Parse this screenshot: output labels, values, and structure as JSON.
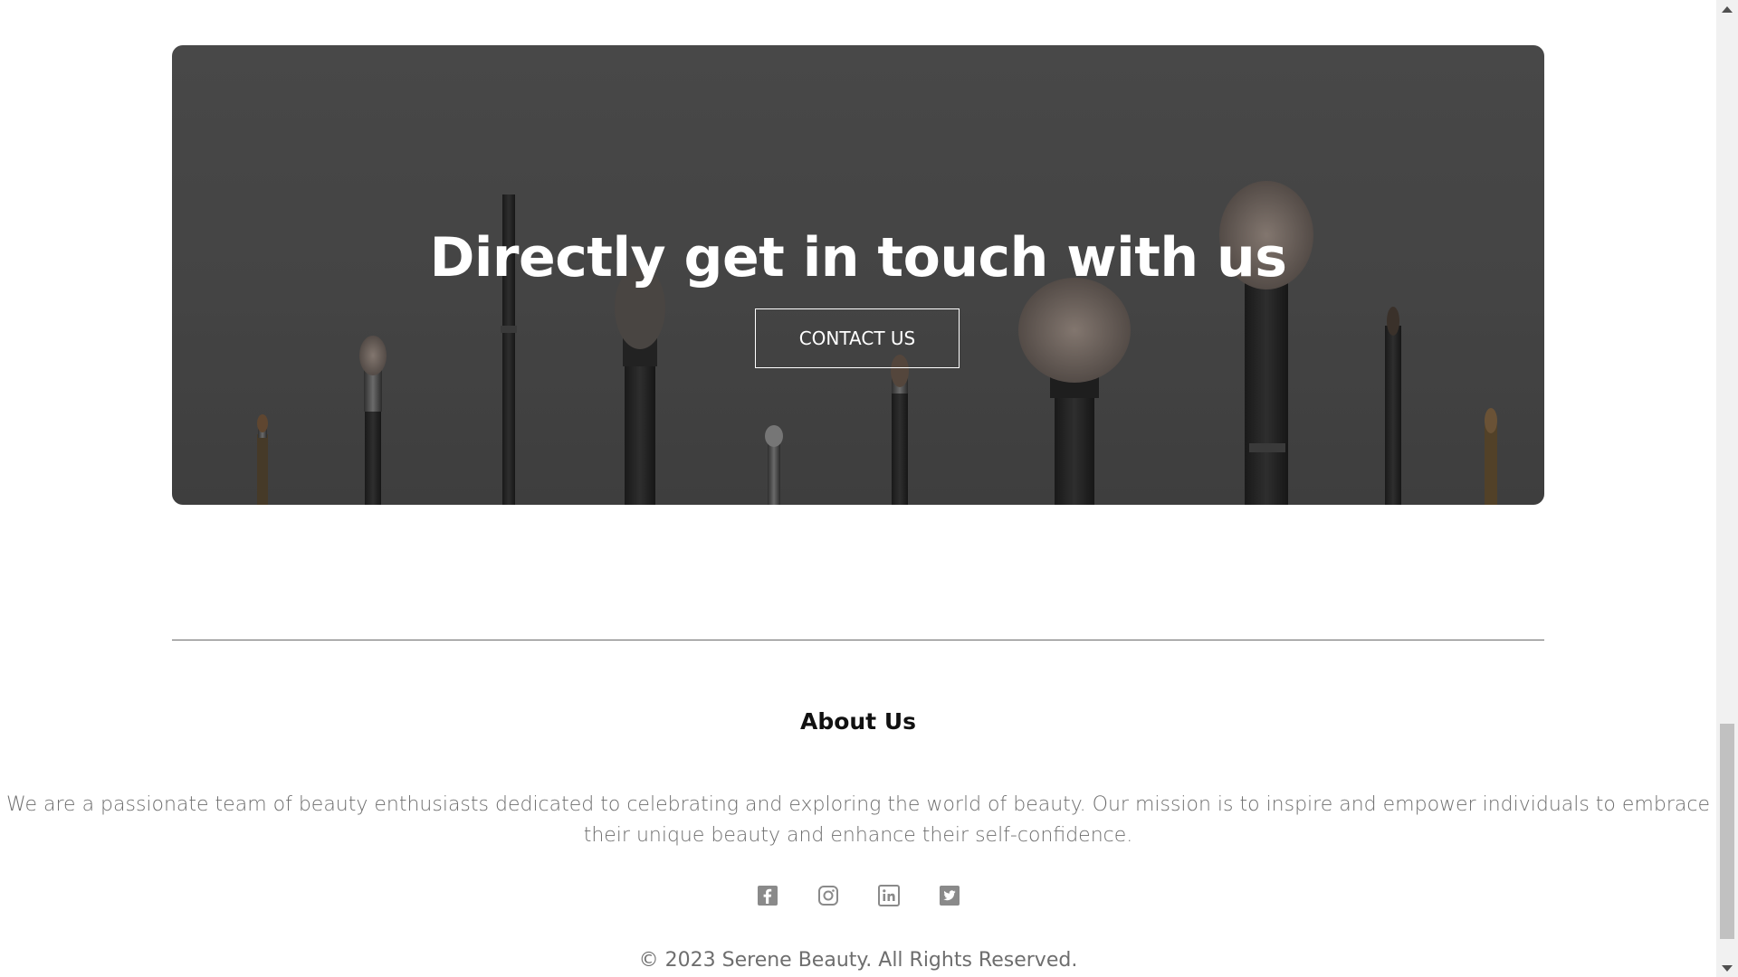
{
  "cta": {
    "title": "Directly get in touch with us",
    "button_label": "CONTACT US"
  },
  "footer": {
    "title": "About Us",
    "description": "We are a passionate team of beauty enthusiasts dedicated to celebrating and exploring the world of beauty. Our mission is to inspire and empower individuals to embrace their unique beauty and enhance their self-confidence.",
    "socials": [
      {
        "icon": "facebook-icon"
      },
      {
        "icon": "instagram-icon"
      },
      {
        "icon": "linkedin-icon"
      },
      {
        "icon": "twitter-icon"
      }
    ],
    "copyright": "© 2023 Serene Beauty. All Rights Reserved."
  },
  "colors": {
    "overlay": "#474747",
    "icon": "#8a8a8a",
    "text_muted": "#6e6e6e"
  }
}
